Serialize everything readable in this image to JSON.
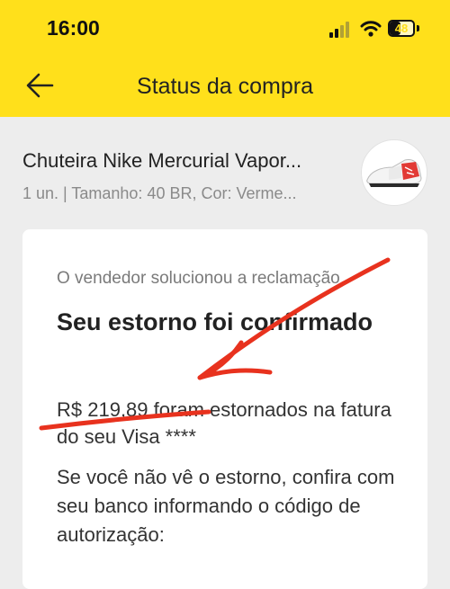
{
  "status_bar": {
    "time": "16:00",
    "battery": "48",
    "battery_level": 0.48
  },
  "header": {
    "title": "Status da compra",
    "bg_color": "#ffe01b"
  },
  "product": {
    "name": "Chuteira Nike Mercurial Vapor...",
    "meta": "1 un. | Tamanho: 40 BR, Cor: Verme..."
  },
  "card": {
    "subtitle": "O vendedor solucionou a reclamação",
    "heading": "Seu estorno foi confirmado",
    "amount": "R$ 219,89",
    "refund_text": "foram estornados na fatura do seu Visa ****",
    "help_text": "Se você não vê o estorno, confira com seu banco informando o código de autorização:"
  },
  "annotation_color": "#e8321e"
}
